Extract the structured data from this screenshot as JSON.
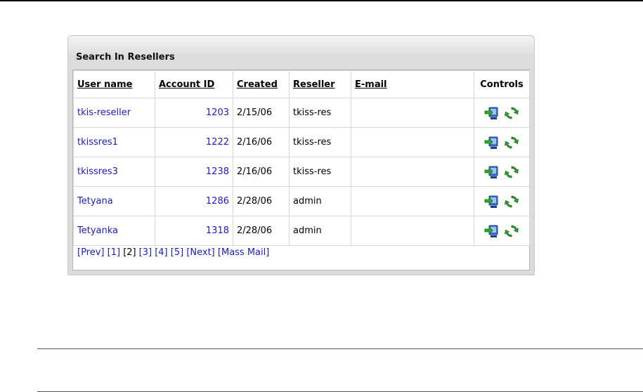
{
  "panel": {
    "title": "Search In Resellers"
  },
  "table": {
    "columns": [
      "User name",
      "Account ID",
      "Created",
      "Reseller",
      "E-mail",
      "Controls"
    ],
    "rows": [
      {
        "user": "tkis-reseller",
        "id": "1203",
        "created": "2/15/06",
        "reseller": "tkiss-res",
        "email": ""
      },
      {
        "user": "tkissres1",
        "id": "1222",
        "created": "2/16/06",
        "reseller": "tkiss-res",
        "email": ""
      },
      {
        "user": "tkissres3",
        "id": "1238",
        "created": "2/16/06",
        "reseller": "tkiss-res",
        "email": ""
      },
      {
        "user": "Tetyana",
        "id": "1286",
        "created": "2/28/06",
        "reseller": "admin",
        "email": ""
      },
      {
        "user": "Tetyanka",
        "id": "1318",
        "created": "2/28/06",
        "reseller": "admin",
        "email": ""
      }
    ]
  },
  "pager": {
    "prev": "[Prev]",
    "p1": "[1]",
    "p2": "[2]",
    "p3": "[3]",
    "p4": "[4]",
    "p5": "[5]",
    "next": "[Next]",
    "mass_mail": "[Mass Mail]"
  },
  "icons": {
    "login": "login-as-user-icon",
    "refresh": "refresh-icon"
  },
  "colors": {
    "link": "#1a1acc",
    "icon_green": "#2eaa2e",
    "icon_blue": "#2a62c8"
  }
}
